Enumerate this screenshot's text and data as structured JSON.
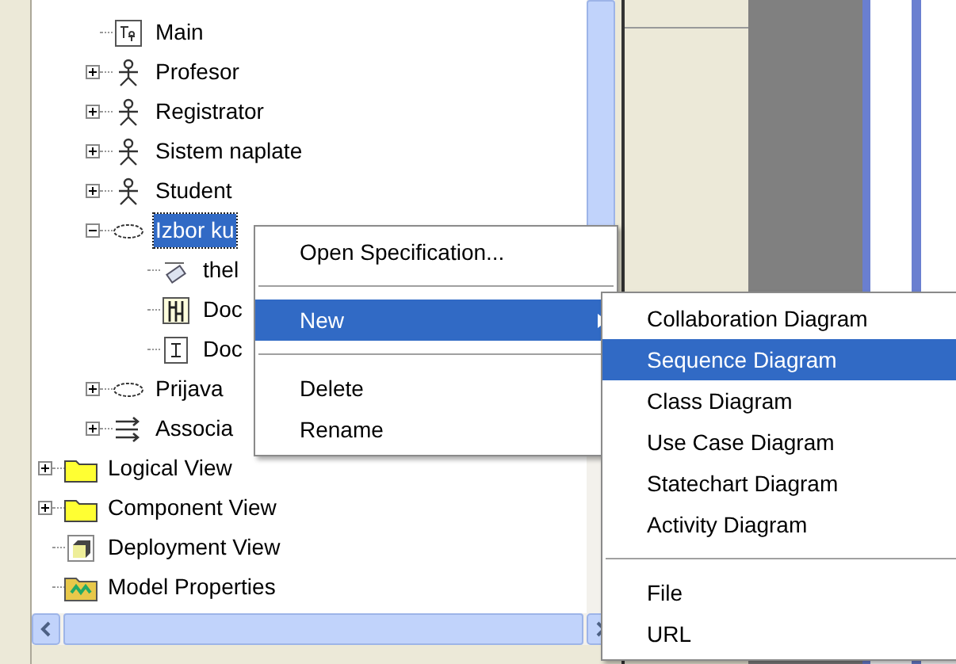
{
  "tree": {
    "nested_items": [
      {
        "label": "Main",
        "kind": "diagram"
      },
      {
        "label": "Profesor",
        "kind": "actor",
        "expanded": false
      },
      {
        "label": "Registrator",
        "kind": "actor",
        "expanded": false
      },
      {
        "label": "Sistem naplate",
        "kind": "actor",
        "expanded": false
      },
      {
        "label": "Student",
        "kind": "actor",
        "expanded": false
      },
      {
        "label": "Izbor ku",
        "kind": "usecase",
        "expanded": true,
        "selected": true,
        "children": [
          {
            "label": "thel",
            "kind": "note"
          },
          {
            "label": "Doc",
            "kind": "sequence"
          },
          {
            "label": "Doc",
            "kind": "document"
          }
        ]
      },
      {
        "label": "Prijava",
        "kind": "usecase",
        "expanded": false
      },
      {
        "label": "Associa",
        "kind": "association",
        "expanded": false
      }
    ],
    "items": [
      {
        "label": "Logical View",
        "kind": "folder",
        "expanded": false
      },
      {
        "label": "Component View",
        "kind": "folder",
        "expanded": false
      },
      {
        "label": "Deployment View",
        "kind": "deployment"
      },
      {
        "label": "Model Properties",
        "kind": "properties"
      }
    ]
  },
  "context_menu": {
    "items": [
      {
        "kind": "item",
        "label": "Open Specification...",
        "selected": false
      },
      {
        "kind": "separator"
      },
      {
        "kind": "submenu",
        "label": "New",
        "selected": true
      },
      {
        "kind": "separator"
      },
      {
        "kind": "item",
        "label": "Delete",
        "selected": false
      },
      {
        "kind": "item",
        "label": "Rename",
        "selected": false
      }
    ]
  },
  "submenu": {
    "items": [
      {
        "kind": "item",
        "label": "Collaboration Diagram",
        "selected": false
      },
      {
        "kind": "item",
        "label": "Sequence Diagram",
        "selected": true
      },
      {
        "kind": "item",
        "label": "Class Diagram",
        "selected": false
      },
      {
        "kind": "item",
        "label": "Use Case Diagram",
        "selected": false
      },
      {
        "kind": "item",
        "label": "Statechart Diagram",
        "selected": false
      },
      {
        "kind": "item",
        "label": "Activity Diagram",
        "selected": false
      },
      {
        "kind": "separator"
      },
      {
        "kind": "item",
        "label": "File",
        "selected": false
      },
      {
        "kind": "item",
        "label": "URL",
        "selected": false
      }
    ]
  }
}
